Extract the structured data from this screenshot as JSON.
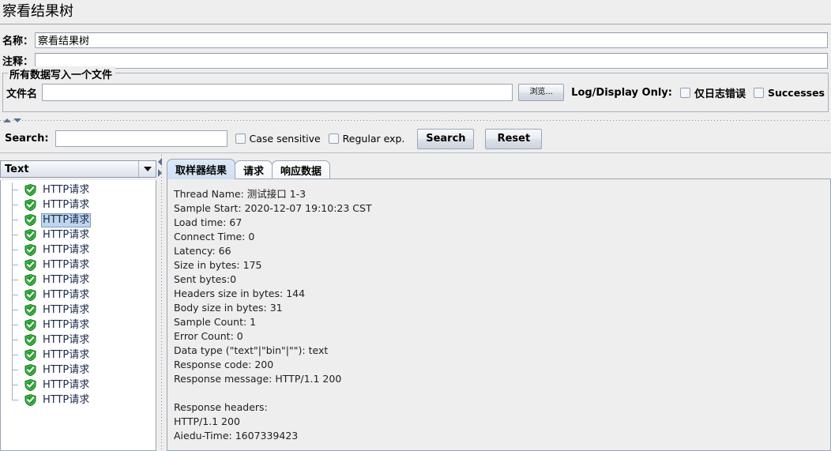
{
  "window": {
    "title": "察看结果树"
  },
  "form": {
    "name_label": "名称：",
    "name_value": "察看结果树",
    "comment_label": "注释：",
    "comment_value": ""
  },
  "file_group": {
    "title": "所有数据写入一个文件",
    "filename_label": "文件名",
    "filename_value": "",
    "browse_button": "浏览...",
    "log_display_label": "Log/Display Only:",
    "errors_only_checkbox": "仅日志错误",
    "errors_only_checked": false,
    "successes_checkbox": "Successes",
    "successes_checked": false
  },
  "search": {
    "label": "Search:",
    "value": "",
    "case_sensitive_label": "Case sensitive",
    "case_sensitive_checked": false,
    "regular_exp_label": "Regular exp.",
    "regular_exp_checked": false,
    "search_button": "Search",
    "reset_button": "Reset"
  },
  "tree": {
    "render_selector_value": "Text",
    "selected_index": 2,
    "items": [
      {
        "label": "HTTP请求",
        "status": "success"
      },
      {
        "label": "HTTP请求",
        "status": "success"
      },
      {
        "label": "HTTP请求",
        "status": "success"
      },
      {
        "label": "HTTP请求",
        "status": "success"
      },
      {
        "label": "HTTP请求",
        "status": "success"
      },
      {
        "label": "HTTP请求",
        "status": "success"
      },
      {
        "label": "HTTP请求",
        "status": "success"
      },
      {
        "label": "HTTP请求",
        "status": "success"
      },
      {
        "label": "HTTP请求",
        "status": "success"
      },
      {
        "label": "HTTP请求",
        "status": "success"
      },
      {
        "label": "HTTP请求",
        "status": "success"
      },
      {
        "label": "HTTP请求",
        "status": "success"
      },
      {
        "label": "HTTP请求",
        "status": "success"
      },
      {
        "label": "HTTP请求",
        "status": "success"
      },
      {
        "label": "HTTP请求",
        "status": "success"
      }
    ]
  },
  "tabs": {
    "active_index": 0,
    "items": [
      {
        "label": "取样器结果"
      },
      {
        "label": "请求"
      },
      {
        "label": "响应数据"
      }
    ]
  },
  "sampler_result": {
    "lines": [
      "Thread Name: 测试接口 1-3",
      "Sample Start: 2020-12-07 19:10:23 CST",
      "Load time: 67",
      "Connect Time: 0",
      "Latency: 66",
      "Size in bytes: 175",
      "Sent bytes:0",
      "Headers size in bytes: 144",
      "Body size in bytes: 31",
      "Sample Count: 1",
      "Error Count: 0",
      "Data type (\"text\"|\"bin\"|\"\"): text",
      "Response code: 200",
      "Response message: HTTP/1.1 200",
      "",
      "Response headers:",
      "HTTP/1.1 200",
      "Aiedu-Time: 1607339423"
    ]
  },
  "colors": {
    "window_bg": "#eeeeee",
    "border": "#9aa5b5",
    "selection": "#bfd5ee",
    "success_green": "#22a02a",
    "tab_active": "#cfe0f4"
  }
}
